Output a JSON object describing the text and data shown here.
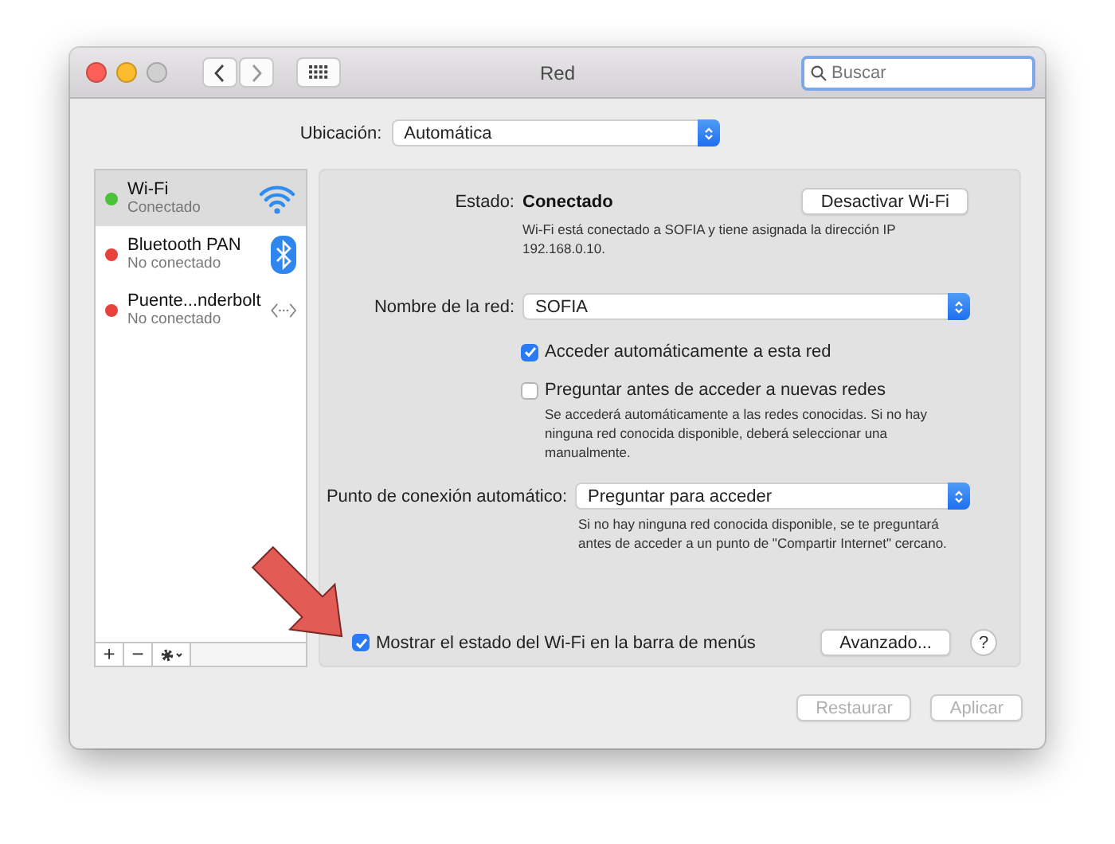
{
  "window": {
    "title": "Red",
    "search": {
      "placeholder": "Buscar"
    }
  },
  "location": {
    "label": "Ubicación:",
    "value": "Automática"
  },
  "services": [
    {
      "name": "Wi-Fi",
      "status": "Conectado",
      "color": "#4cc23a",
      "selected": true,
      "kind": "wifi"
    },
    {
      "name": "Bluetooth PAN",
      "status": "No conectado",
      "color": "#e8413c",
      "selected": false,
      "kind": "bluetooth"
    },
    {
      "name": "Puente...nderbolt",
      "status": "No conectado",
      "color": "#e8413c",
      "selected": false,
      "kind": "bridge"
    }
  ],
  "sidebar_toolbar": {
    "add": "+",
    "remove": "−"
  },
  "status": {
    "label": "Estado:",
    "value": "Conectado",
    "button": "Desactivar Wi-Fi",
    "description": "Wi-Fi está conectado a SOFIA y tiene asignada la dirección IP 192.168.0.10."
  },
  "network_name": {
    "label": "Nombre de la red:",
    "value": "SOFIA"
  },
  "options": [
    {
      "label": "Acceder automáticamente a esta red",
      "checked": true
    },
    {
      "label": "Preguntar antes de acceder a nuevas redes",
      "checked": false,
      "note": "Se accederá automáticamente a las redes conocidas. Si no hay ninguna red conocida disponible, deberá seleccionar una manualmente."
    }
  ],
  "hotspot": {
    "label": "Punto de conexión automático:",
    "value": "Preguntar para acceder",
    "note": "Si no hay ninguna red conocida disponible, se te preguntará antes de acceder a un punto de \"Compartir Internet\" cercano."
  },
  "show_in_menu_bar": {
    "label": "Mostrar el estado del Wi-Fi en la barra de menús",
    "checked": true
  },
  "advanced_button": "Avanzado...",
  "help_button": "?",
  "footer_buttons": [
    {
      "label": "Restaurar",
      "disabled": true
    },
    {
      "label": "Aplicar",
      "disabled": true
    }
  ]
}
